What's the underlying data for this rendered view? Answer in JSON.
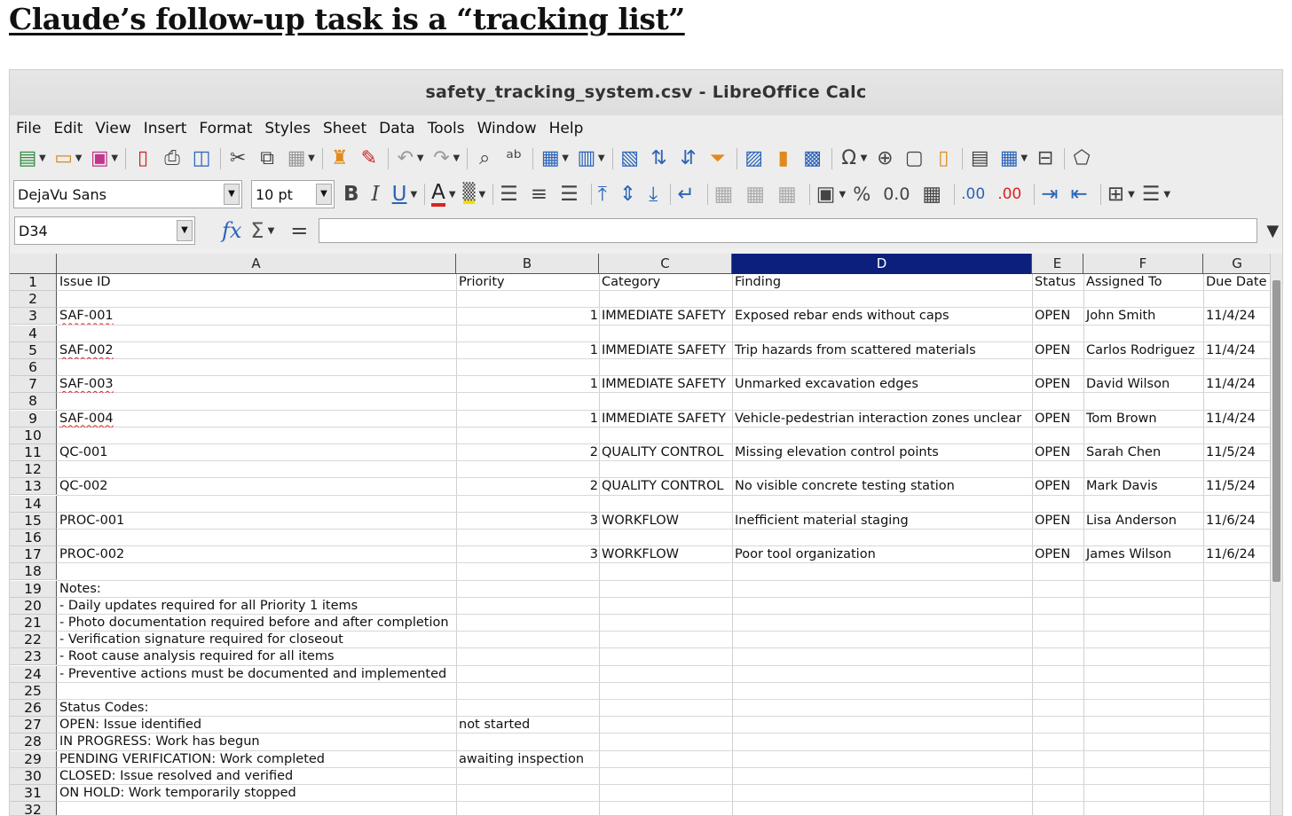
{
  "heading": "Claude’s follow-up task is a “tracking list”",
  "window": {
    "title": "safety_tracking_system.csv - LibreOffice Calc"
  },
  "menu": [
    "File",
    "Edit",
    "View",
    "Insert",
    "Format",
    "Styles",
    "Sheet",
    "Data",
    "Tools",
    "Window",
    "Help"
  ],
  "toolbar": {
    "font_name": "DejaVu Sans",
    "font_size": "10 pt",
    "bold": "B",
    "italic": "I",
    "underline": "U",
    "percent": "%",
    "number_format": "0.0",
    "add_decimal": ".00",
    "del_decimal": ".00"
  },
  "formula_bar": {
    "name_box": "D34",
    "fx": "fx",
    "sigma": "Σ",
    "equals": "=",
    "content": ""
  },
  "columns": [
    {
      "letter": "A",
      "selected": false
    },
    {
      "letter": "B",
      "selected": false
    },
    {
      "letter": "C",
      "selected": false
    },
    {
      "letter": "D",
      "selected": true
    },
    {
      "letter": "E",
      "selected": false
    },
    {
      "letter": "F",
      "selected": false
    },
    {
      "letter": "G",
      "selected": false
    }
  ],
  "rows": [
    {
      "n": "1",
      "A": "Issue ID",
      "B": "Priority",
      "C": "Category",
      "D": "Finding",
      "E": "Status",
      "F": "Assigned To",
      "G": "Due Date"
    },
    {
      "n": "2"
    },
    {
      "n": "3",
      "A": "SAF-001",
      "B": "1",
      "C": "IMMEDIATE SAFETY",
      "D": "Exposed rebar ends without caps",
      "E": "OPEN",
      "F": "John Smith",
      "G": "11/4/24"
    },
    {
      "n": "4"
    },
    {
      "n": "5",
      "A": "SAF-002",
      "B": "1",
      "C": "IMMEDIATE SAFETY",
      "D": "Trip hazards from scattered materials",
      "E": "OPEN",
      "F": "Carlos Rodriguez",
      "G": "11/4/24"
    },
    {
      "n": "6"
    },
    {
      "n": "7",
      "A": "SAF-003",
      "B": "1",
      "C": "IMMEDIATE SAFETY",
      "D": "Unmarked excavation edges",
      "E": "OPEN",
      "F": "David Wilson",
      "G": "11/4/24"
    },
    {
      "n": "8"
    },
    {
      "n": "9",
      "A": "SAF-004",
      "B": "1",
      "C": "IMMEDIATE SAFETY",
      "D": "Vehicle-pedestrian interaction zones unclear",
      "E": "OPEN",
      "F": "Tom Brown",
      "G": "11/4/24"
    },
    {
      "n": "10"
    },
    {
      "n": "11",
      "A": "QC-001",
      "B": "2",
      "C": "QUALITY CONTROL",
      "D": "Missing elevation control points",
      "E": "OPEN",
      "F": "Sarah Chen",
      "G": "11/5/24"
    },
    {
      "n": "12"
    },
    {
      "n": "13",
      "A": "QC-002",
      "B": "2",
      "C": "QUALITY CONTROL",
      "D": "No visible concrete testing station",
      "E": "OPEN",
      "F": "Mark Davis",
      "G": "11/5/24"
    },
    {
      "n": "14"
    },
    {
      "n": "15",
      "A": "PROC-001",
      "B": "3",
      "C": "WORKFLOW",
      "D": "Inefficient material staging",
      "E": "OPEN",
      "F": "Lisa Anderson",
      "G": "11/6/24"
    },
    {
      "n": "16"
    },
    {
      "n": "17",
      "A": "PROC-002",
      "B": "3",
      "C": "WORKFLOW",
      "D": "Poor tool organization",
      "E": "OPEN",
      "F": "James Wilson",
      "G": "11/6/24"
    },
    {
      "n": "18"
    },
    {
      "n": "19",
      "A": "Notes:"
    },
    {
      "n": "20",
      "A": "- Daily updates required for all Priority 1 items"
    },
    {
      "n": "21",
      "A": "- Photo documentation required before and after completion"
    },
    {
      "n": "22",
      "A": "- Verification signature required for closeout"
    },
    {
      "n": "23",
      "A": "- Root cause analysis required for all items"
    },
    {
      "n": "24",
      "A": "- Preventive actions must be documented and implemented"
    },
    {
      "n": "25"
    },
    {
      "n": "26",
      "A": "Status Codes:"
    },
    {
      "n": "27",
      "A": "OPEN: Issue identified",
      "B": " not started"
    },
    {
      "n": "28",
      "A": "IN PROGRESS: Work has begun"
    },
    {
      "n": "29",
      "A": "PENDING VERIFICATION: Work completed",
      "B": " awaiting inspection"
    },
    {
      "n": "30",
      "A": "CLOSED: Issue resolved and verified"
    },
    {
      "n": "31",
      "A": "ON HOLD: Work temporarily stopped"
    },
    {
      "n": "32"
    }
  ]
}
